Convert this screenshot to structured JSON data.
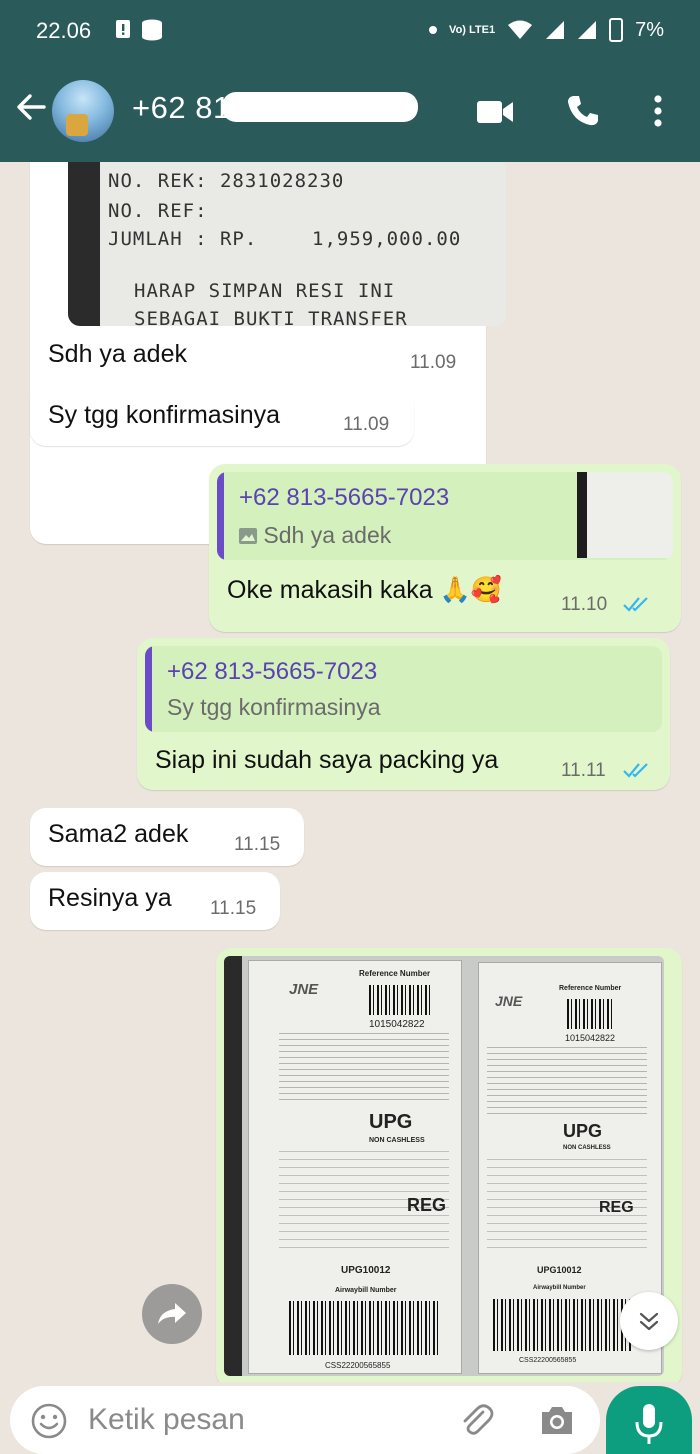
{
  "status_bar": {
    "time": "22.06",
    "battery": "7%",
    "network": "Vo) LTE1"
  },
  "header": {
    "contact_name": "+62 81",
    "icons": [
      "back-arrow-icon",
      "video-call-icon",
      "phone-icon",
      "more-options-icon"
    ]
  },
  "receipt": {
    "lines": [
      "NO. REK: 2831028230",
      "NO. REF:",
      "JUMLAH : RP.",
      "1,959,000.00",
      "HARAP SIMPAN RESI INI",
      "SEBAGAI BUKTI TRANSFER"
    ]
  },
  "messages": [
    {
      "id": "m1",
      "direction": "incoming",
      "text": "Sdh ya adek",
      "time": "11.09"
    },
    {
      "id": "m2",
      "direction": "incoming",
      "text": "Sy tgg konfirmasinya",
      "time": "11.09"
    },
    {
      "id": "m3",
      "direction": "outgoing",
      "quote_name": "+62 813-5665-7023",
      "quote_text": "Sdh ya adek",
      "text": "Oke makasih kaka",
      "emoji": "🙏🥰",
      "time": "11.10"
    },
    {
      "id": "m4",
      "direction": "outgoing",
      "quote_name": "+62 813-5665-7023",
      "quote_text": "Sy tgg konfirmasinya",
      "text": "Siap ini sudah saya packing ya",
      "time": "11.11"
    },
    {
      "id": "m5",
      "direction": "incoming",
      "text": "Sama2 adek",
      "time": "11.15"
    },
    {
      "id": "m6",
      "direction": "incoming",
      "text": "Resinya ya",
      "time": "11.15"
    }
  ],
  "waybill": {
    "labels": [
      {
        "brand": "JNE",
        "ref_title": "Reference Number",
        "ref_no": "1015042822",
        "dest": "UPG",
        "payment": "NON CASHLESS",
        "service": "REG",
        "code": "UPG10012",
        "airway_title": "Airwaybill Number",
        "airway_no": "CSS22200565855"
      },
      {
        "brand": "JNE",
        "ref_title": "Reference Number",
        "ref_no": "1015042822",
        "dest": "UPG",
        "payment": "NON CASHLESS",
        "service": "REG",
        "code": "UPG10012",
        "airway_title": "Airwaybill Number",
        "airway_no": "CSS22200565855"
      }
    ]
  },
  "composer": {
    "placeholder": "Ketik pesan",
    "icons": [
      "emoji-icon",
      "attach-icon",
      "camera-icon",
      "mic-icon"
    ]
  },
  "colors": {
    "header_bg": "#2a5b5a",
    "incoming_bubble": "#ffffff",
    "outgoing_bubble": "#e1f7cb",
    "read_ticks": "#34b7f1",
    "mic_button": "#0d9e80"
  }
}
